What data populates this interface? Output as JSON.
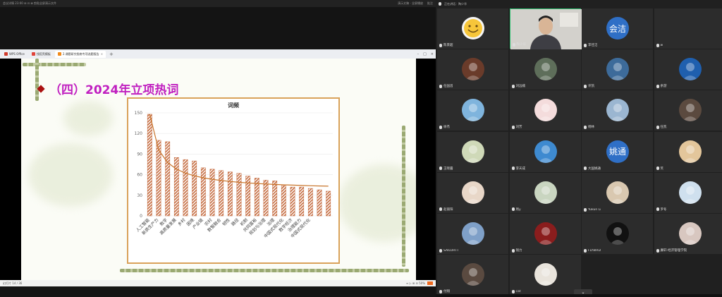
{
  "meeting": {
    "topbar_left": "会议详情   23:00   ⊞  ⊟  ⊠  剪贴全屏演示文件",
    "topbar_mid": "演示文稿 · 全屏播放",
    "topbar_right": "批注",
    "gallery_header": "正在讲话：陶少华"
  },
  "browser": {
    "tabs": [
      {
        "label": "WPS Office",
        "color": "#d03b2c",
        "active": false
      },
      {
        "label": "找稻壳模板",
        "color": "#e0433a",
        "active": false
      },
      {
        "label": "2.课题研究指南专项选题报告",
        "color": "#f08a1c",
        "active": true
      }
    ],
    "new_tab": "+",
    "status_left": "幻灯片 14 / 36",
    "status_right": "≡ ▷ ⊞ ⊟ 50%"
  },
  "slide": {
    "title": "（四）2024年立项热词"
  },
  "chart_data": {
    "type": "bar",
    "title": "词频",
    "categories": [
      "人工智能",
      "新质生产力",
      "数字",
      "高质量发展",
      "乡村",
      "困境",
      "产业链",
      "农村",
      "数智融合",
      "韧性",
      "路径",
      "机制",
      "共同富裕",
      "规划与治理",
      "治理",
      "中国式现代化",
      "数字经济",
      "治理能力",
      "中国式现代化"
    ],
    "values": [
      148,
      110,
      108,
      85,
      82,
      80,
      70,
      68,
      66,
      64,
      62,
      58,
      55,
      52,
      51,
      44,
      42,
      42,
      40,
      38,
      36
    ],
    "ylim": [
      0,
      150
    ],
    "yticks": [
      0,
      30,
      60,
      90,
      120,
      150
    ],
    "trendline": true,
    "bar_color": "#c46a3e",
    "frame_color": "#d9a25a"
  },
  "participants": [
    {
      "name": "陈景超",
      "avatar": "smiley",
      "bg": "#f5f5f5"
    },
    {
      "name": "陶少华",
      "avatar": "camera",
      "bg": "#cfcfca",
      "speaking": true
    },
    {
      "name": "李佳洁",
      "avatar": "text",
      "text": "会洁",
      "bg": "#2f6fc6"
    },
    {
      "name": "w",
      "avatar": "none",
      "bg": "#2c2c2c"
    },
    {
      "name": "任国昌",
      "avatar": "photo",
      "bg": "#6a3b2a"
    },
    {
      "name": "刘远楠",
      "avatar": "photo",
      "bg": "#5e6e5a"
    },
    {
      "name": "许凯",
      "avatar": "photo",
      "bg": "#3d6b9a"
    },
    {
      "name": "余游",
      "avatar": "photo",
      "bg": "#1f5fae"
    },
    {
      "name": "徐杰",
      "avatar": "photo",
      "bg": "#7fb4dd"
    },
    {
      "name": "刘芳",
      "avatar": "photo",
      "bg": "#f4dcdc"
    },
    {
      "name": "杨林",
      "avatar": "photo",
      "bg": "#9bb6d1"
    },
    {
      "name": "任凯",
      "avatar": "photo",
      "bg": "#5b4a3f"
    },
    {
      "name": "王晓露",
      "avatar": "photo",
      "bg": "#cfd9b8"
    },
    {
      "name": "李天成",
      "avatar": "photo",
      "bg": "#3e8ad0"
    },
    {
      "name": "大国姚通",
      "avatar": "text",
      "text": "姚通",
      "bg": "#2f6fc6"
    },
    {
      "name": "笑",
      "avatar": "photo",
      "bg": "#e3c69b"
    },
    {
      "name": "赵丽阳",
      "avatar": "photo",
      "bg": "#e8d7c8"
    },
    {
      "name": "周y",
      "avatar": "photo",
      "bg": "#c9d5c0"
    },
    {
      "name": "Yukun Li",
      "avatar": "photo",
      "bg": "#d9c8b0"
    },
    {
      "name": "罗冬",
      "avatar": "photo",
      "bg": "#cfe0ee"
    },
    {
      "name": "SAILORTT",
      "avatar": "photo",
      "bg": "#7fa0c8"
    },
    {
      "name": "钱力",
      "avatar": "photo",
      "bg": "#8a1d1d"
    },
    {
      "name": "FLY8IRD",
      "avatar": "photo",
      "bg": "#111111"
    },
    {
      "name": "廉轩-经济管理学院",
      "avatar": "photo",
      "bg": "#d8c7c0"
    },
    {
      "name": "付翔",
      "avatar": "photo",
      "bg": "#5a4a40"
    },
    {
      "name": "cat",
      "avatar": "photo",
      "bg": "#e9e4dc"
    }
  ]
}
